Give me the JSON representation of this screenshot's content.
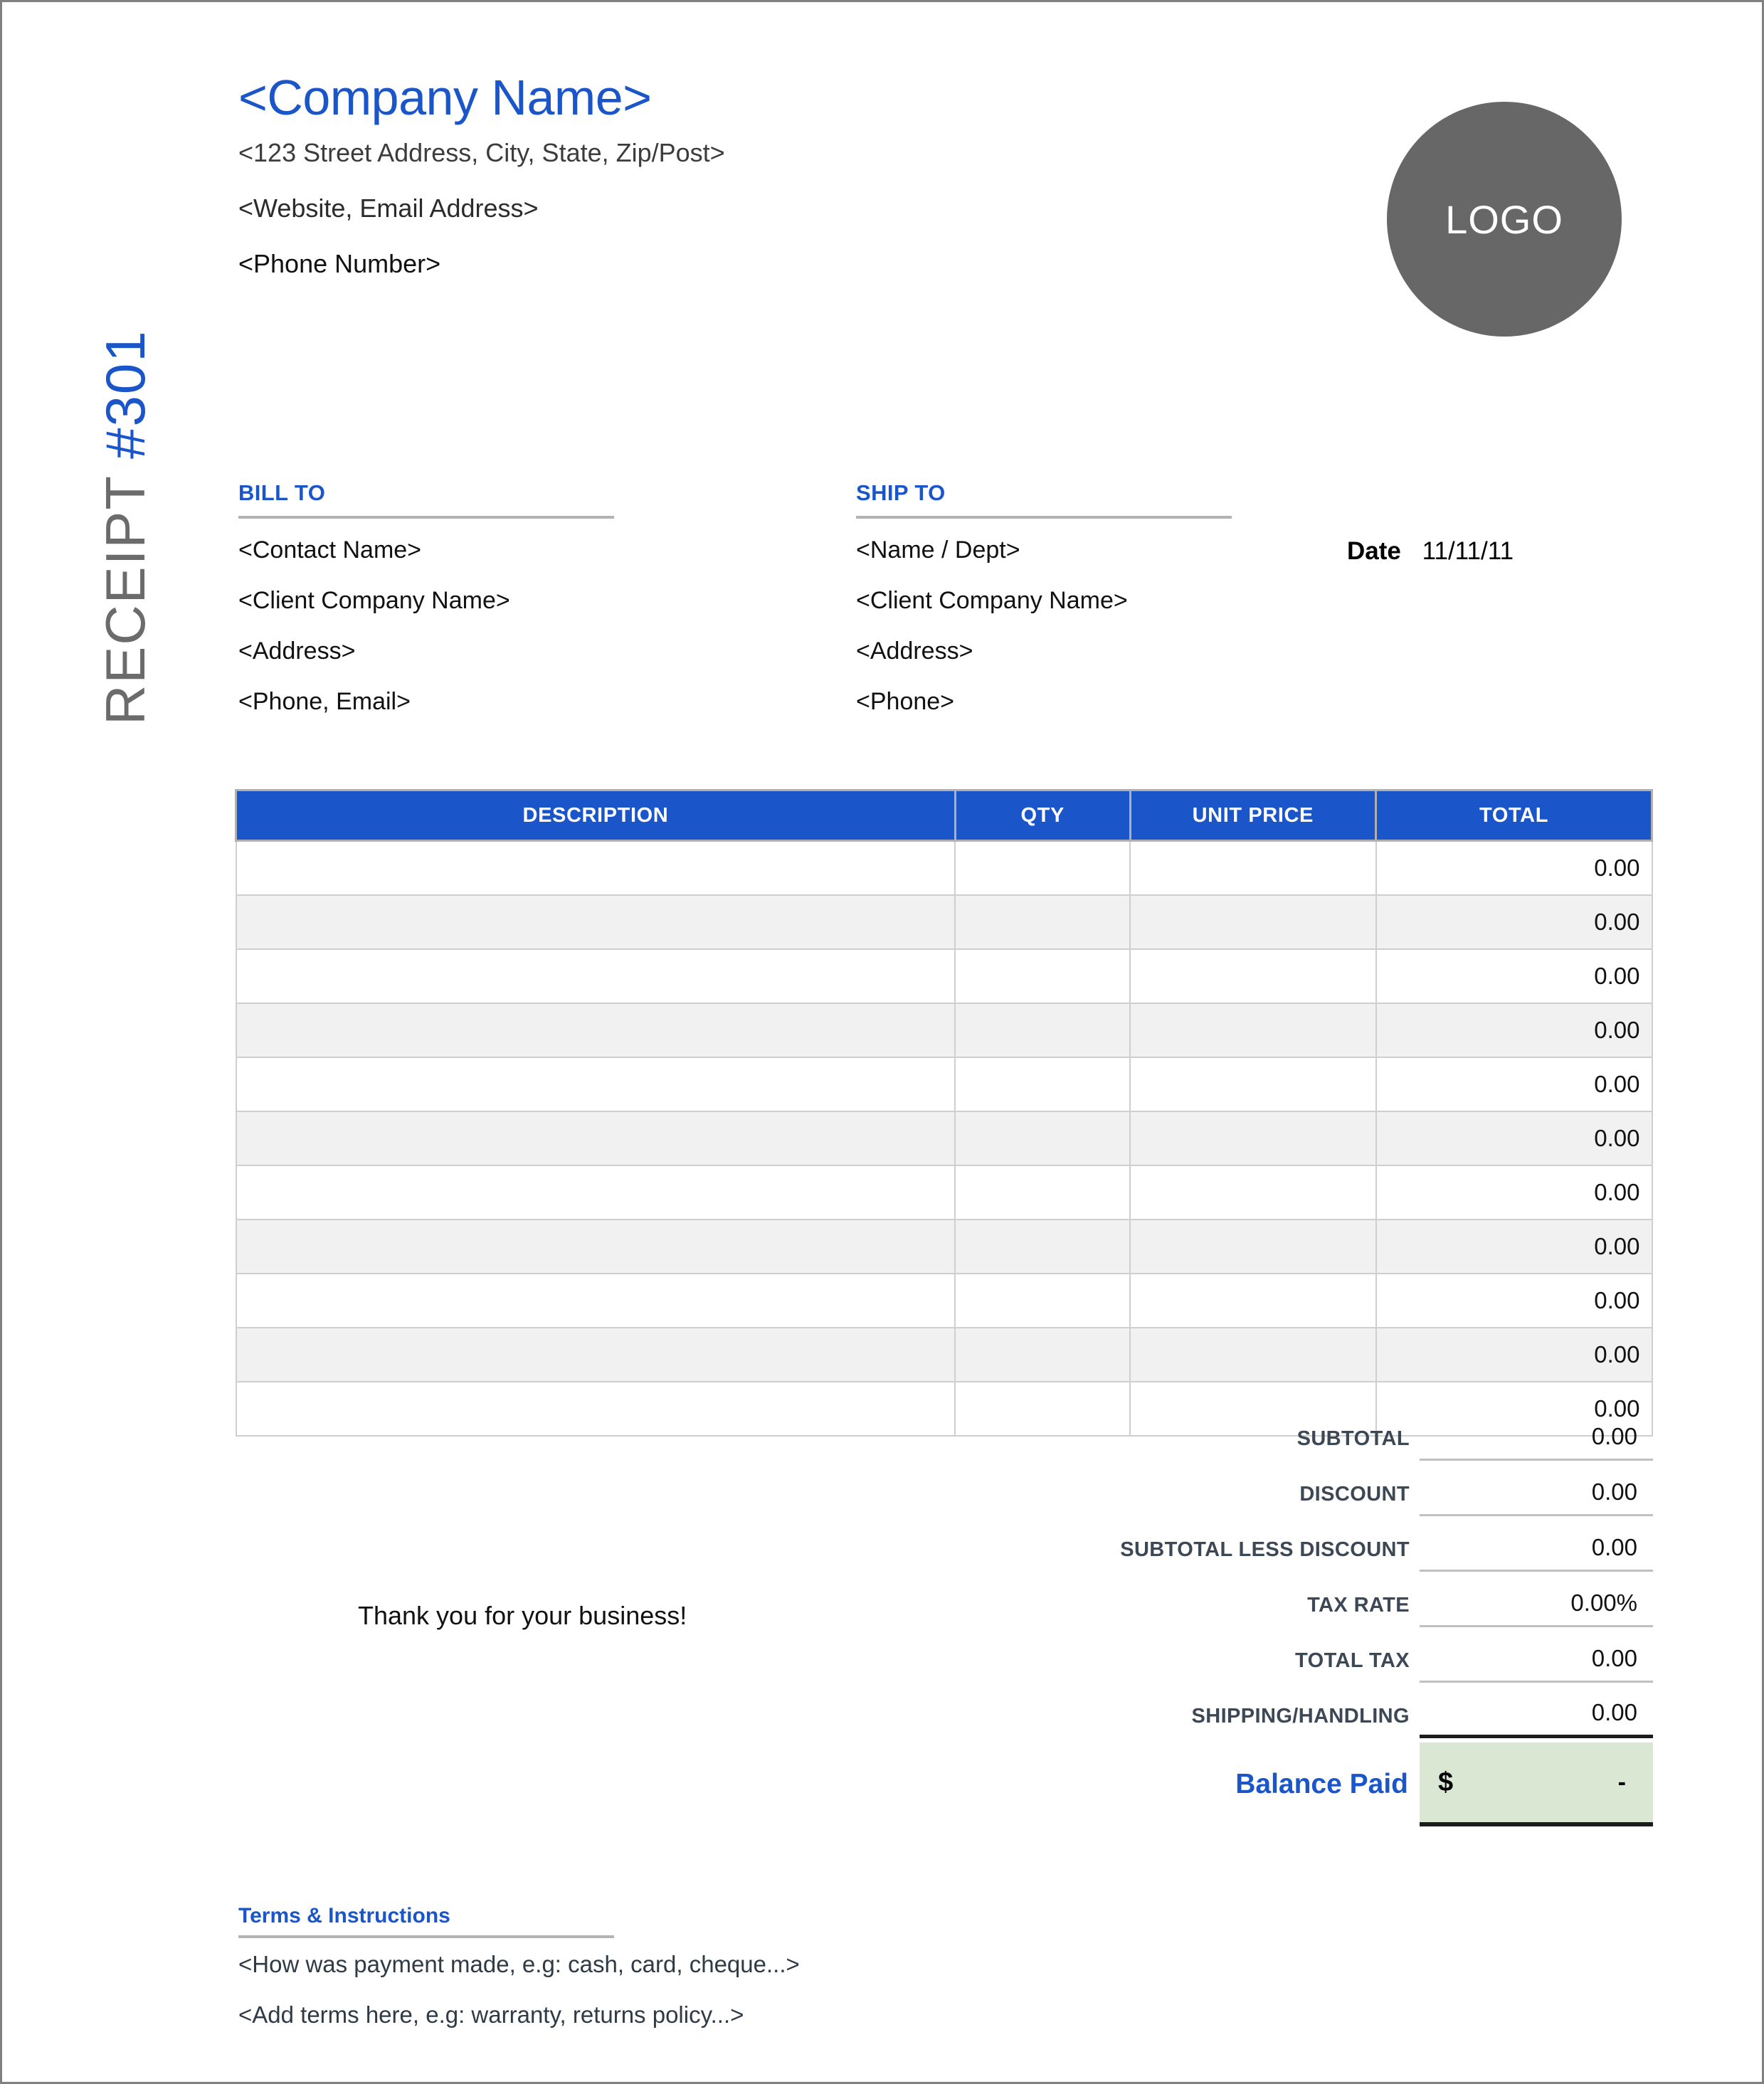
{
  "document": {
    "title_word": "RECEIPT",
    "title_number": "#301"
  },
  "colors": {
    "accent_blue": "#1a56c9",
    "logo_gray": "#676767",
    "balance_green": "#dae8d3",
    "totals_label": "#3c4856"
  },
  "company": {
    "name": "<Company Name>",
    "street": "<123 Street Address, City, State, Zip/Post>",
    "web_email": "<Website, Email Address>",
    "phone": "<Phone Number>"
  },
  "logo": {
    "label": "LOGO"
  },
  "bill_to": {
    "heading": "BILL TO",
    "lines": [
      "<Contact Name>",
      "<Client Company Name>",
      "<Address>",
      "<Phone, Email>"
    ]
  },
  "ship_to": {
    "heading": "SHIP TO",
    "lines": [
      "<Name / Dept>",
      "<Client Company Name>",
      "<Address>",
      "<Phone>"
    ]
  },
  "date": {
    "label": "Date",
    "value": "11/11/11"
  },
  "items_table": {
    "headers": [
      "DESCRIPTION",
      "QTY",
      "UNIT PRICE",
      "TOTAL"
    ],
    "rows": [
      {
        "description": "",
        "qty": "",
        "unit_price": "",
        "total": "0.00"
      },
      {
        "description": "",
        "qty": "",
        "unit_price": "",
        "total": "0.00"
      },
      {
        "description": "",
        "qty": "",
        "unit_price": "",
        "total": "0.00"
      },
      {
        "description": "",
        "qty": "",
        "unit_price": "",
        "total": "0.00"
      },
      {
        "description": "",
        "qty": "",
        "unit_price": "",
        "total": "0.00"
      },
      {
        "description": "",
        "qty": "",
        "unit_price": "",
        "total": "0.00"
      },
      {
        "description": "",
        "qty": "",
        "unit_price": "",
        "total": "0.00"
      },
      {
        "description": "",
        "qty": "",
        "unit_price": "",
        "total": "0.00"
      },
      {
        "description": "",
        "qty": "",
        "unit_price": "",
        "total": "0.00"
      },
      {
        "description": "",
        "qty": "",
        "unit_price": "",
        "total": "0.00"
      },
      {
        "description": "",
        "qty": "",
        "unit_price": "",
        "total": "0.00"
      }
    ]
  },
  "totals": {
    "rows": [
      {
        "label": "SUBTOTAL",
        "value": "0.00"
      },
      {
        "label": "DISCOUNT",
        "value": "0.00"
      },
      {
        "label": "SUBTOTAL LESS DISCOUNT",
        "value": "0.00"
      },
      {
        "label": "TAX RATE",
        "value": "0.00%"
      },
      {
        "label": "TOTAL TAX",
        "value": "0.00"
      },
      {
        "label": "SHIPPING/HANDLING",
        "value": "0.00"
      }
    ],
    "balance": {
      "label": "Balance Paid",
      "currency": "$",
      "value": "-"
    }
  },
  "thank_you": "Thank you for your business!",
  "terms": {
    "heading": "Terms & Instructions",
    "lines": [
      "<How was payment made, e.g: cash, card, cheque...>",
      "<Add terms here, e.g: warranty, returns policy...>"
    ]
  }
}
